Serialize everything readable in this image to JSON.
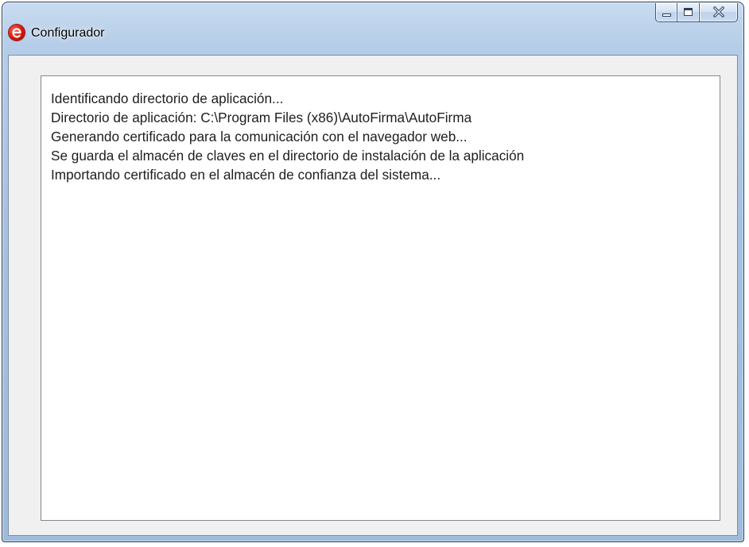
{
  "window": {
    "title": "Configurador",
    "icon": "autofirma-logo-icon",
    "controls": {
      "minimize_icon": "minimize-icon",
      "maximize_icon": "maximize-icon",
      "close_icon": "close-icon"
    }
  },
  "log": {
    "lines": [
      "Identificando directorio de aplicación...",
      "Directorio de aplicación: C:\\Program Files (x86)\\AutoFirma\\AutoFirma",
      "Generando certificado para la comunicación con el navegador web...",
      "Se guarda el almacén de claves en el directorio de instalación de la aplicación",
      "Importando certificado en el almacén de confianza del sistema..."
    ]
  },
  "colors": {
    "frame": "#a6c2e2",
    "client_background": "#f0f0f0",
    "text_area_background": "#ffffff",
    "app_icon_red": "#d8150b"
  }
}
